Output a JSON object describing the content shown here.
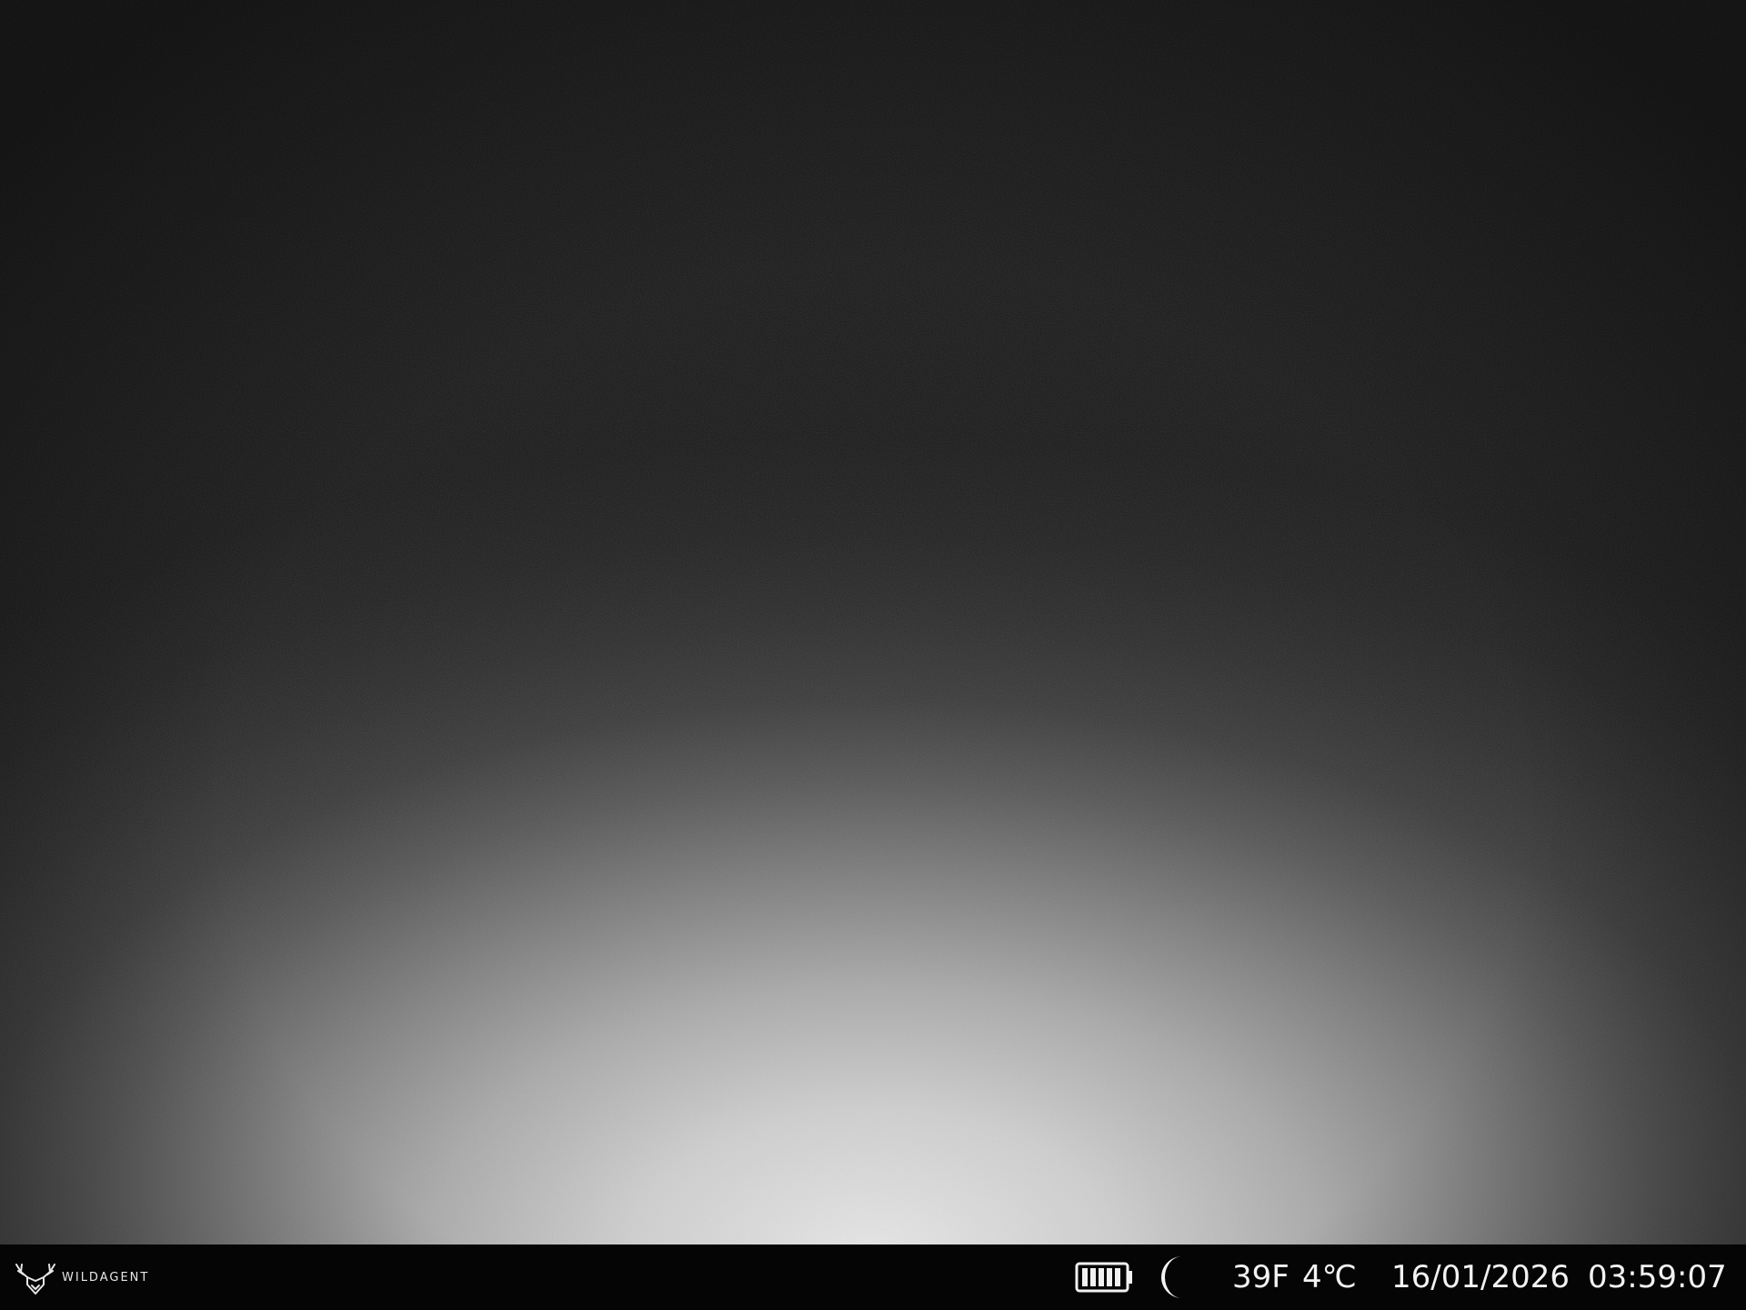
{
  "brand": {
    "name": "WILDAGENT",
    "logo_icon": "deer-antler-logo-icon"
  },
  "status": {
    "battery_icon": "battery-full-icon",
    "battery_level": 1.0,
    "mode_icon": "moon-night-icon",
    "temp_f": "39F",
    "temp_c": "4℃",
    "date": "16/01/2026",
    "time": "03:59:07"
  },
  "colors": {
    "bar_background": "#050505",
    "text": "#f2f2f2"
  }
}
